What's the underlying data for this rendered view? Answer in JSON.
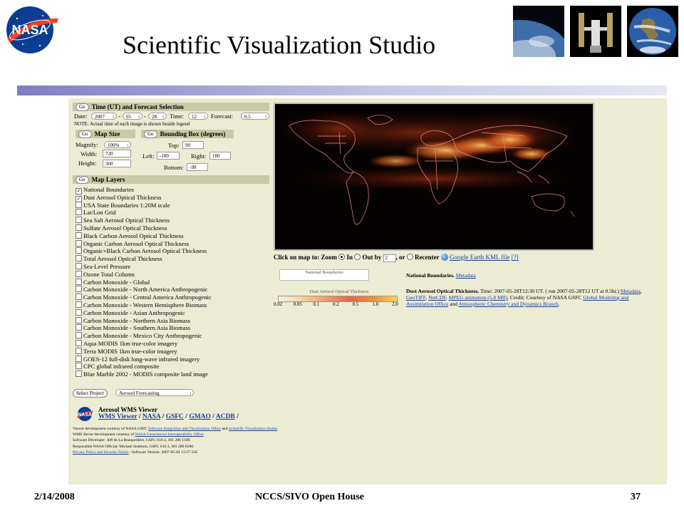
{
  "slide": {
    "title": "Scientific Visualization Studio",
    "footer_date": "2/14/2008",
    "footer_title": "NCCS/SIVO Open House",
    "footer_page": "37"
  },
  "time_section": {
    "go": "Go",
    "heading": "Time (UT) and Forecast Selection",
    "date_label": "Date:",
    "year": "2007",
    "month": "05",
    "dash1": "-",
    "dash2": "-",
    "day": "28",
    "time_label": "Time:",
    "time": "12",
    "forecast_label": "Forecast:",
    "forecast": "0.5",
    "note": "NOTE: Actual time of each image is shown beside legend"
  },
  "map_size": {
    "go": "Go",
    "heading": "Map Size",
    "magnify_label": "Magnify:",
    "magnify": "100%",
    "width_label": "Width:",
    "width": "720",
    "height_label": "Height:",
    "height": "360"
  },
  "bbox": {
    "go": "Go",
    "heading": "Bounding Box (degrees)",
    "top_label": "Top:",
    "top": "90",
    "left_label": "Left:",
    "left": "-180",
    "right_label": "Right:",
    "right": "180",
    "bottom_label": "Bottom:",
    "bottom": "-90"
  },
  "layers": {
    "go": "Go",
    "heading": "Map Layers",
    "items": [
      {
        "label": "National Boundaries",
        "checked": true
      },
      {
        "label": "Dust Aerosol Optical Thickness",
        "checked": true
      },
      {
        "label": "USA State Boundaries 1:20M scale",
        "checked": false
      },
      {
        "label": "Lat/Lon Grid",
        "checked": false
      },
      {
        "label": "Sea Salt Aerosol Optical Thickness",
        "checked": false
      },
      {
        "label": "Sulfate Aerosol Optical Thickness",
        "checked": false
      },
      {
        "label": "Black Carbon Aerosol Optical Thickness",
        "checked": false
      },
      {
        "label": "Organic Carbon Aerosol Optical Thickness",
        "checked": false
      },
      {
        "label": "Organic+Black Carbon Aerosol Optical Thickness",
        "checked": false
      },
      {
        "label": "Total Aerosol Optical Thickness",
        "checked": false
      },
      {
        "label": "Sea-Level Pressure",
        "checked": false
      },
      {
        "label": "Ozone Total Column",
        "checked": false
      },
      {
        "label": "Carbon Monoxide - Global",
        "checked": false
      },
      {
        "label": "Carbon Monoxide - North America Anthropogenic",
        "checked": false
      },
      {
        "label": "Carbon Monoxide - Central America Anthropogenic",
        "checked": false
      },
      {
        "label": "Carbon Monoxide - Western Hemisphere Biomass",
        "checked": false
      },
      {
        "label": "Carbon Monoxide - Asian Anthropogenic",
        "checked": false
      },
      {
        "label": "Carbon Monoxide - Northern Asia Biomass",
        "checked": false
      },
      {
        "label": "Carbon Monoxide - Southern Asia Biomass",
        "checked": false
      },
      {
        "label": "Carbon Monoxide - Mexico City Anthropogenic",
        "checked": false
      },
      {
        "label": "Aqua MODIS 1km true-color imagery",
        "checked": false
      },
      {
        "label": "Terra MODIS 1km true-color imagery",
        "checked": false
      },
      {
        "label": "GOES-12 full-disk long-wave infrared imagery",
        "checked": false
      },
      {
        "label": "CPC global infrared composite",
        "checked": false
      },
      {
        "label": "Blue Marble 2002 - MODIS composite land image",
        "checked": false
      }
    ]
  },
  "project": {
    "button": "Select Project",
    "value": "Aerosol Forecasting"
  },
  "viewer": {
    "title": "Aerosol WMS Viewer",
    "links": [
      "WMS Viewer",
      "NASA",
      "GSFC",
      "GMAO",
      "ACDB"
    ],
    "sep": "/",
    "credits": [
      {
        "pre": "Viewer development courtesy of NASA GSFC ",
        "link": "Software Integration and Visualization Office",
        "mid": " and ",
        "link2": "Scientific Visualization Studio",
        "post": "."
      },
      {
        "pre": "WMS Server development courtesy of ",
        "link": "NASA Geosciences Interoperability Office",
        "mid": "",
        "link2": "",
        "post": "."
      },
      {
        "pre": "Software Developer: Jeff de La Beaujardière, GSFC 610.3, 301 286 1569.",
        "link": "",
        "mid": "",
        "link2": "",
        "post": ""
      },
      {
        "pre": "Responsible NASA Official: Michael Seablom, GSFC 610.3, 301 286 8580.",
        "link": "",
        "mid": "",
        "link2": "",
        "post": ""
      },
      {
        "pre": "",
        "link": "Privacy Policy and Security Notice",
        "mid": " / Software Version: 2007-05-04 13:57:33Z",
        "link2": "",
        "post": ""
      }
    ]
  },
  "map_controls": {
    "click_label": "Click on map to:",
    "zoom_label": "Zoom",
    "in_label": "In",
    "out_label": "Out by",
    "out_factor": "2",
    "or_label": ", or",
    "recenter_label": "Recenter",
    "kml_link": "Google Earth KML file",
    "help_link": "[?]"
  },
  "legends": {
    "boundaries_legend_title": "National Boundaries",
    "boundaries_label": "National Boundaries.",
    "boundaries_metadata": "Metadata",
    "dust_legend_title": "Dust Aerosol Optical Thickness",
    "ticks": [
      "0.02",
      "0.05",
      "0.1",
      "0.2",
      "0.5",
      "1.0",
      "2.0"
    ],
    "dust_label": "Dust Aerosol Optical Thickness.",
    "dust_time": " Time: 2007-05-28T12:30 UT. ( run 2007-05-28T12 UT at 0.5hr.)",
    "dust_links": [
      "Metadata",
      "GeoTIFF",
      "NetCDF",
      "MPEG animation (5.8 MB)"
    ],
    "dust_credit": ". Credit: Courtesy of NASA GSFC ",
    "dust_credit_link1": "Global Modeling and Assimilation Office",
    "dust_and": " and ",
    "dust_credit_link2": "Atmospheric Chemistry and Dynamics Branch",
    "dust_end": "."
  },
  "colors": {
    "panel_bg": "#ecebd3",
    "section_head": "#c9c9a8",
    "link": "#1a3fa0",
    "map_bg": "#000000",
    "boundary": "#f08a8a",
    "dust_high": "#f0a040"
  }
}
